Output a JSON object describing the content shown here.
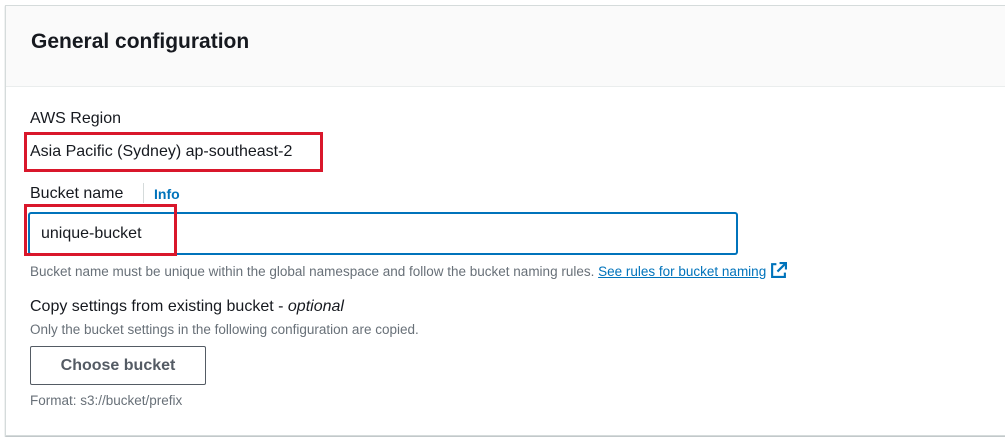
{
  "section": {
    "title": "General configuration"
  },
  "region": {
    "label": "AWS Region",
    "value": "Asia Pacific (Sydney) ap-southeast-2"
  },
  "bucket_name": {
    "label": "Bucket name",
    "info_link": "Info",
    "value": "unique-bucket",
    "help_text": "Bucket name must be unique within the global namespace and follow the bucket naming rules.",
    "help_link": "See rules for bucket naming",
    "help_link_icon": "external-link-icon"
  },
  "copy_settings": {
    "label": "Copy settings from existing bucket - ",
    "label_optional": "optional",
    "description": "Only the bucket settings in the following configuration are copied.",
    "button_label": "Choose bucket",
    "format_hint": "Format: s3://bucket/prefix"
  },
  "colors": {
    "link": "#0073bb",
    "annotation_highlight": "#d9172b",
    "input_focus_border": "#0073bb"
  }
}
